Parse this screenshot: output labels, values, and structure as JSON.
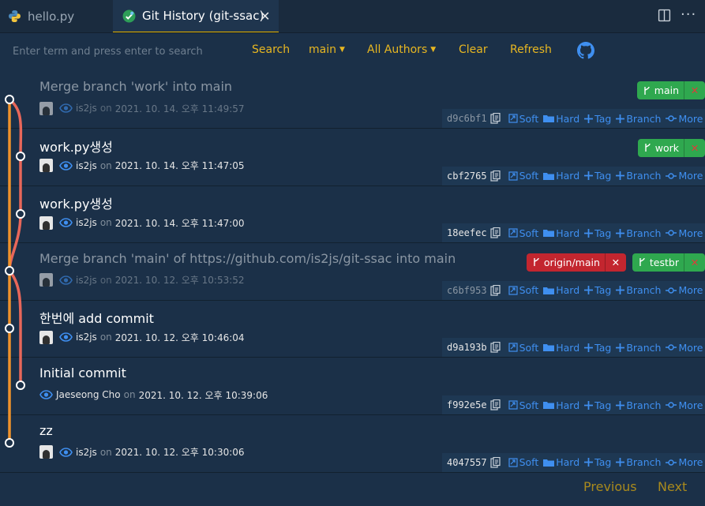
{
  "tabs": [
    {
      "label": "hello.py",
      "icon": "python-icon"
    },
    {
      "label": "Git History (git-ssac)",
      "icon": "git-history-icon",
      "active": true
    }
  ],
  "toolbar": {
    "search_placeholder": "Enter term and press enter to search",
    "search_label": "Search",
    "branch_label": "main",
    "authors_label": "All Authors",
    "clear_label": "Clear",
    "refresh_label": "Refresh",
    "github_icon": "github-icon"
  },
  "actions": {
    "soft": "Soft",
    "hard": "Hard",
    "tag": "Tag",
    "branch": "Branch",
    "more": "More"
  },
  "on_word": "on",
  "commits": [
    {
      "message": "Merge branch 'work' into main",
      "author": "is2js",
      "date": "2021. 10. 14. 오후 11:49:57",
      "hash": "d9c6bf1",
      "merge": true,
      "avatar": true,
      "refs": [
        {
          "name": "main",
          "color": "green"
        }
      ]
    },
    {
      "message": "work.py생성",
      "author": "is2js",
      "date": "2021. 10. 14. 오후 11:47:05",
      "hash": "cbf2765",
      "merge": false,
      "avatar": true,
      "refs": [
        {
          "name": "work",
          "color": "green"
        }
      ]
    },
    {
      "message": "work.py생성",
      "author": "is2js",
      "date": "2021. 10. 14. 오후 11:47:00",
      "hash": "18eefec",
      "merge": false,
      "avatar": true,
      "refs": []
    },
    {
      "message": "Merge branch 'main' of https://github.com/is2js/git-ssac into main",
      "author": "is2js",
      "date": "2021. 10. 12. 오후 10:53:52",
      "hash": "c6bf953",
      "merge": true,
      "avatar": true,
      "refs": [
        {
          "name": "origin/main",
          "color": "red"
        },
        {
          "name": "testbr",
          "color": "green"
        }
      ]
    },
    {
      "message": "한번에 add commit",
      "author": "is2js",
      "date": "2021. 10. 12. 오후 10:46:04",
      "hash": "d9a193b",
      "merge": false,
      "avatar": true,
      "refs": []
    },
    {
      "message": "Initial commit",
      "author": "Jaeseong Cho",
      "date": "2021. 10. 12. 오후 10:39:06",
      "hash": "f992e5e",
      "merge": false,
      "avatar": false,
      "refs": []
    },
    {
      "message": "zz",
      "author": "is2js",
      "date": "2021. 10. 12. 오후 10:30:06",
      "hash": "4047557",
      "merge": false,
      "avatar": true,
      "refs": []
    }
  ],
  "pager": {
    "previous": "Previous",
    "next": "Next"
  },
  "colors": {
    "accent": "#e8b721",
    "link": "#3f8ff0",
    "graph_orange": "#f0922b",
    "graph_red": "#e8675a",
    "ref_green": "#2fa84f",
    "ref_red": "#c3262f"
  }
}
